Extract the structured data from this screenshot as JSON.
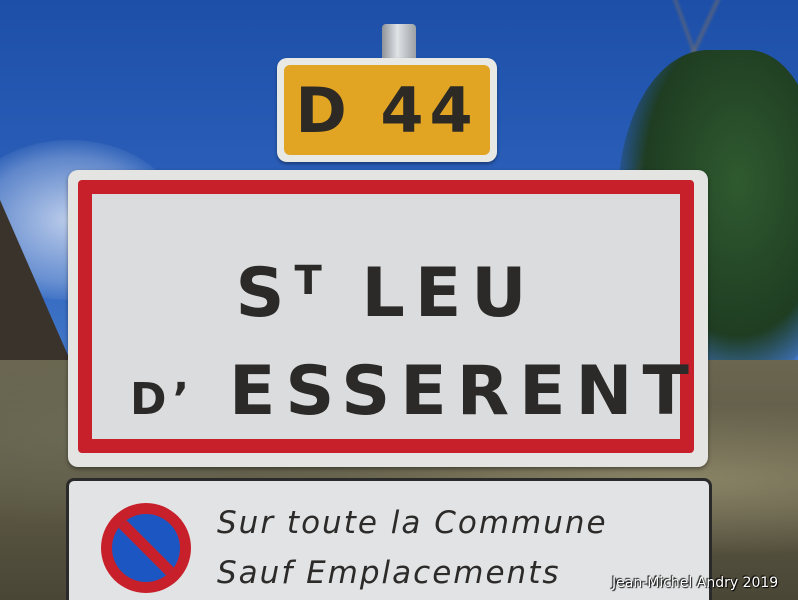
{
  "route_sign": {
    "label": "D 44",
    "colors": {
      "panel": "#e1a523",
      "text": "#2d2a25"
    }
  },
  "town_sign": {
    "line1_main": "S",
    "line1_sup": "T",
    "line1_rest": "LEU",
    "line2_prefix": "D’",
    "line2_main": "ESSERENT",
    "colors": {
      "border": "#c8202a",
      "background": "#dadcdd",
      "text": "#2b2a28"
    }
  },
  "notice_sign": {
    "icon": "no-parking-icon",
    "line1": "Sur toute la Commune",
    "line2": "Sauf Emplacements"
  },
  "credit": "Jean-Michel Andry 2019"
}
